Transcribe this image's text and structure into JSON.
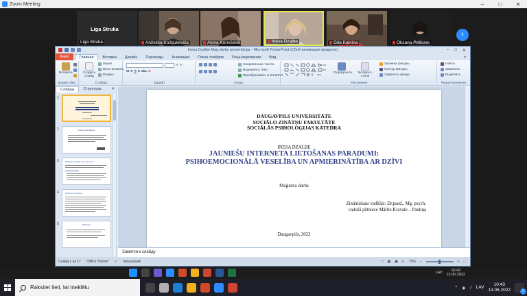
{
  "zoom": {
    "window_title": "Zoom Meeting",
    "speaker_name_large": "Liga Struka",
    "participants": [
      {
        "name": "Liga Struka"
      },
      {
        "name": "Anželika Koštjukeviča"
      },
      {
        "name": "Alona Korniševa"
      },
      {
        "name": "Inesa Dzalbe"
      },
      {
        "name": "Gita Kalnina"
      },
      {
        "name": "Oksana Petkune"
      }
    ]
  },
  "ppt": {
    "title": "Inesa Dzalbe Mag darbs prezentācija  -  Microsoft PowerPoint (Сбой активации продукта)",
    "tabs": [
      "Файл",
      "Главная",
      "Вставка",
      "Дизайн",
      "Переходы",
      "Анимация",
      "Показ слайдов",
      "Рецензирование",
      "Вид"
    ],
    "ribbon_groups": {
      "clipboard": {
        "label": "Буфер обм...",
        "paste": "Вставить",
        "cut": "",
        "copy": ""
      },
      "slides": {
        "label": "Слайды",
        "new_slide": "Создать слайд",
        "layout": "Макет",
        "reset": "Восстановить",
        "section": "Раздел"
      },
      "font": {
        "label": "Шрифт",
        "size": "Aˆ Aˇ"
      },
      "paragraph": {
        "label": "Абзац",
        "direction": "Направление текста",
        "align": "Выровнять текст",
        "smartart": "Преобразовать в SmartArt"
      },
      "drawing": {
        "label": "Рисование",
        "arrange": "Упорядочить",
        "quick_styles": "Экспресс-стили",
        "fill": "Заливка фигуры",
        "outline": "Контур фигуры",
        "effects": "Эффекты фигур"
      },
      "editing": {
        "label": "Редактирование",
        "find": "Найти",
        "replace": "Заменить",
        "select": "Выделить"
      }
    },
    "pane_tabs": [
      "Слайды",
      "Структура"
    ],
    "thumbnails": [
      {
        "num": "1"
      },
      {
        "num": "2",
        "heading": "Tēmas aktualitāte"
      },
      {
        "num": "3",
        "heading": "Pētījuma mērķis un uzdevumi"
      },
      {
        "num": "4",
        "heading": "Pētījuma hipotēze"
      },
      {
        "num": "5",
        "heading": "Metodes"
      }
    ],
    "slide": {
      "univ_line1": "DAUGAVPILS UNIVERSITĀTE",
      "univ_line2": "SOCIĀLO ZINĀTŅU FAKULTĀTE",
      "univ_line3": "SOCIĀLĀS PSIHOLOĢIJAS KATEDRA",
      "author": "INESA DZALBE",
      "title_line1": "JAUNIEŠU INTERNETA LIETOŠANAS PARADUMI:",
      "title_line2": "PSIHOEMOCIONĀLĀ VESELĪBA UN APMIERINĀTĪBA AR DZĪVI",
      "work_type": "Maģistra darbs",
      "supervisor_line1": "Zinātniskais  vadītājs: Dr.paed., Mg. psych.",
      "supervisor_line2": "vadošā pētniece Mārīte Kravale – Pauliņa",
      "place_year": "Daugavpils, 2022"
    },
    "notes_placeholder": "Заметки к слайду",
    "status": {
      "slide_of": "Слайд 1 из 17",
      "theme": "\"Office Theme\"",
      "language": "латышский",
      "zoom": "75%"
    }
  },
  "taskbar": {
    "search_placeholder": "Rakstiet šeit, lai meklētu",
    "language": "LAV",
    "time": "10:43",
    "date": "13.05.2022",
    "ppt_time": "10:43",
    "ppt_date": "13.05.2022",
    "ppt_lang": "LAV",
    "notification_count": "2"
  },
  "colors": {
    "slide_title": "#2f3f86",
    "zoom_accent": "#2d8cff",
    "file_tab": "#e2553a"
  }
}
